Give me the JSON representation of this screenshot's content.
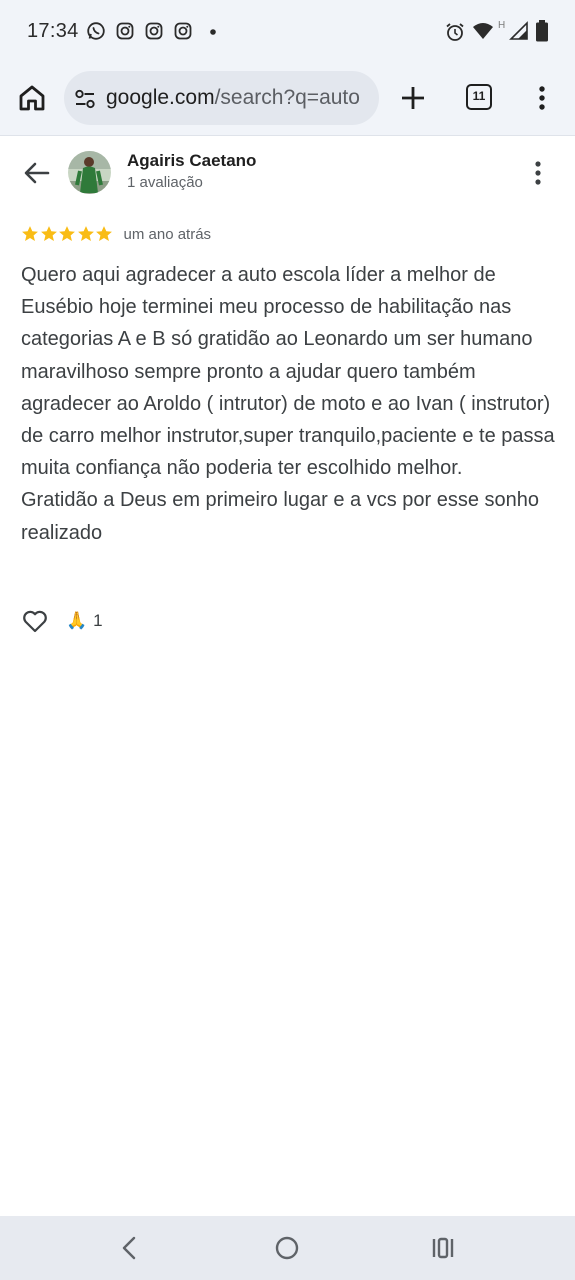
{
  "status_bar": {
    "time": "17:34",
    "notification_icons": [
      "whatsapp-icon",
      "instagram-icon",
      "instagram-icon",
      "instagram-icon",
      "more-dot-icon"
    ],
    "system_icons": [
      "alarm-icon",
      "wifi-icon",
      "signal-h-icon",
      "battery-icon"
    ],
    "network_label": "H"
  },
  "browser": {
    "url_domain": "google.com",
    "url_path": "/search?q=auto",
    "tab_count": "11"
  },
  "review": {
    "author_name": "Agairis Caetano",
    "author_reviews": "1 avaliação",
    "rating": 5,
    "date": "um ano atrás",
    "text": "Quero aqui agradecer a auto escola líder a melhor de Eusébio hoje terminei meu processo de habilitação nas categorias A e B só gratidão ao Leonardo um ser humano maravilhoso sempre pronto a ajudar quero também agradecer ao Aroldo ( intrutor) de moto e ao Ivan ( instrutor) de carro melhor instrutor,super tranquilo,paciente e te passa muita confiança não poderia ter escolhido melhor.\nGratidão a Deus em primeiro lugar e a vcs por esse sonho realizado",
    "reaction_emoji": "🙏",
    "reaction_count": "1"
  },
  "colors": {
    "star": "#f9bc15",
    "toolbar_bg": "#f1f4f9",
    "url_bg": "#e3e7ee",
    "nav_bg": "#e7eaf0"
  }
}
